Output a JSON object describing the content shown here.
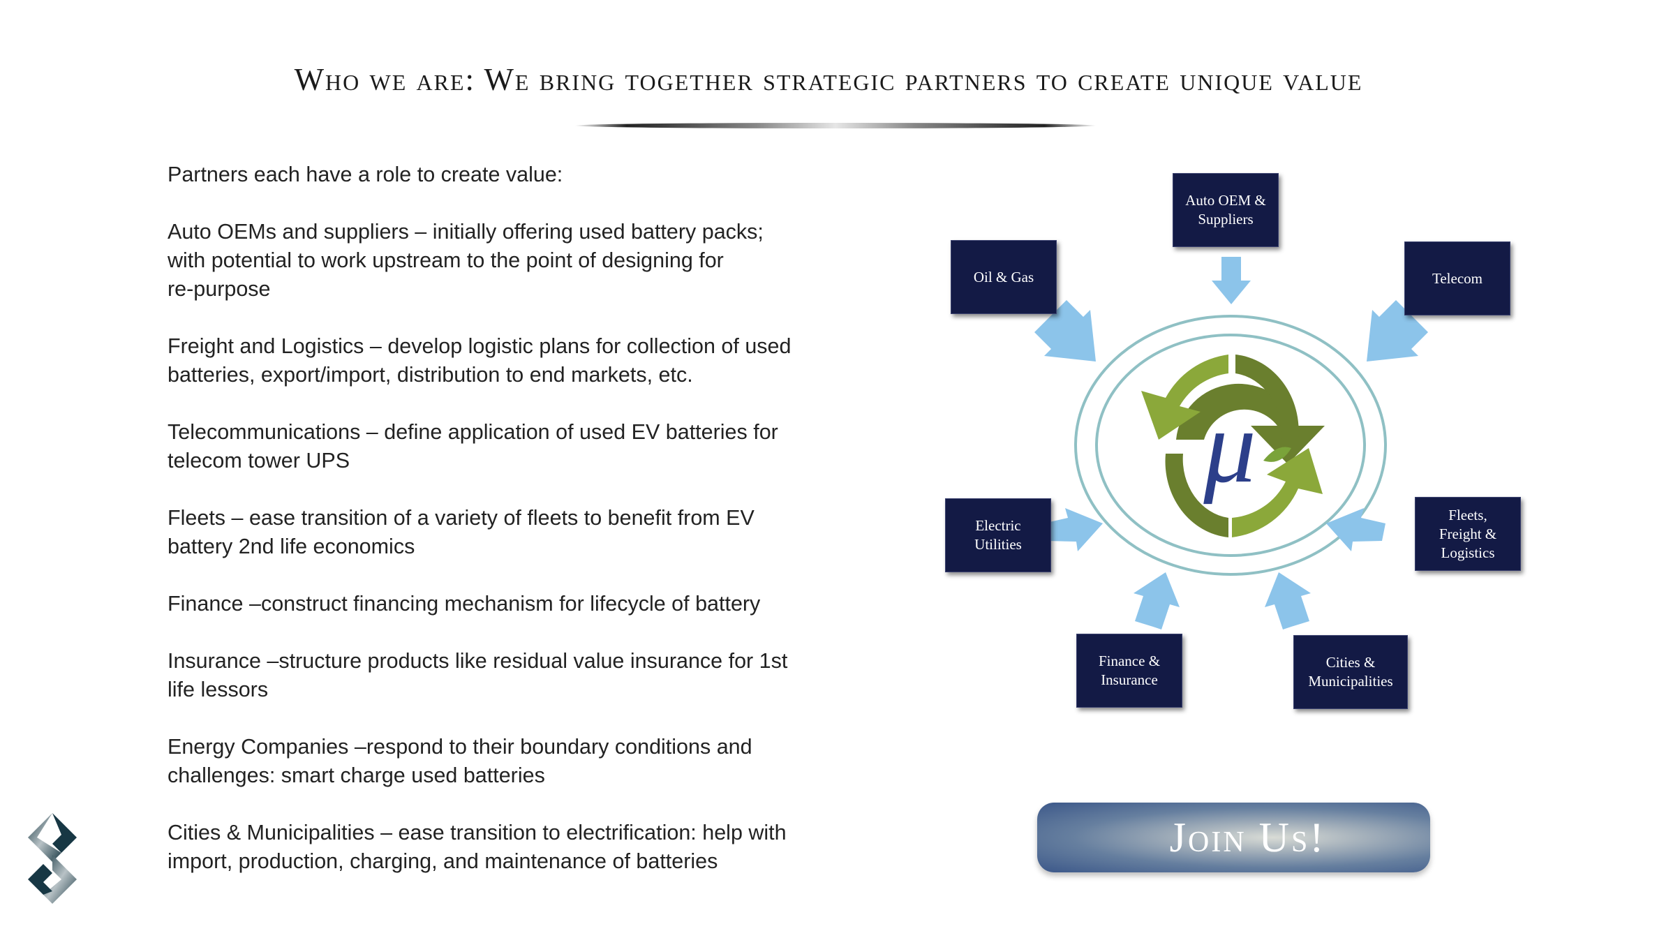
{
  "slide": {
    "title": "Who we are: We bring together strategic partners to create unique value"
  },
  "content": {
    "paragraphs": [
      "Partners each have a role to create value:",
      "Auto OEMs and suppliers – initially offering used battery packs;\nwith potential to work upstream to the point of designing for\nre-purpose",
      "Freight and Logistics – develop logistic plans for collection of used\nbatteries, export/import, distribution to end markets, etc.",
      "Telecommunications – define application of used EV batteries for\ntelecom tower UPS",
      "Fleets – ease transition of a variety of fleets to benefit from EV\nbattery 2nd life economics",
      "Finance –construct financing mechanism for lifecycle of battery",
      "Insurance –structure products like residual value insurance for 1st\nlife lessors",
      "Energy Companies –respond to their boundary conditions and\nchallenges: smart charge used batteries",
      "Cities & Municipalities – ease transition to electrification: help with\nimport, production, charging, and maintenance of batteries"
    ]
  },
  "diagram": {
    "center_logo": "μ",
    "partners": [
      {
        "label": "Auto OEM &\nSuppliers"
      },
      {
        "label": "Oil & Gas"
      },
      {
        "label": "Telecom"
      },
      {
        "label": "Electric\nUtilities"
      },
      {
        "label": "Fleets,\nFreight &\nLogistics"
      },
      {
        "label": "Finance &\nInsurance"
      },
      {
        "label": "Cities &\nMunicipalities"
      }
    ],
    "colors": {
      "box_fill": "#131a45",
      "arrow": "#8cc4ea",
      "ring": "#8fc0c4",
      "cycle_dark": "#6a7f2e",
      "cycle_light": "#93b13d"
    }
  },
  "cta": {
    "label": "Join Us!"
  }
}
